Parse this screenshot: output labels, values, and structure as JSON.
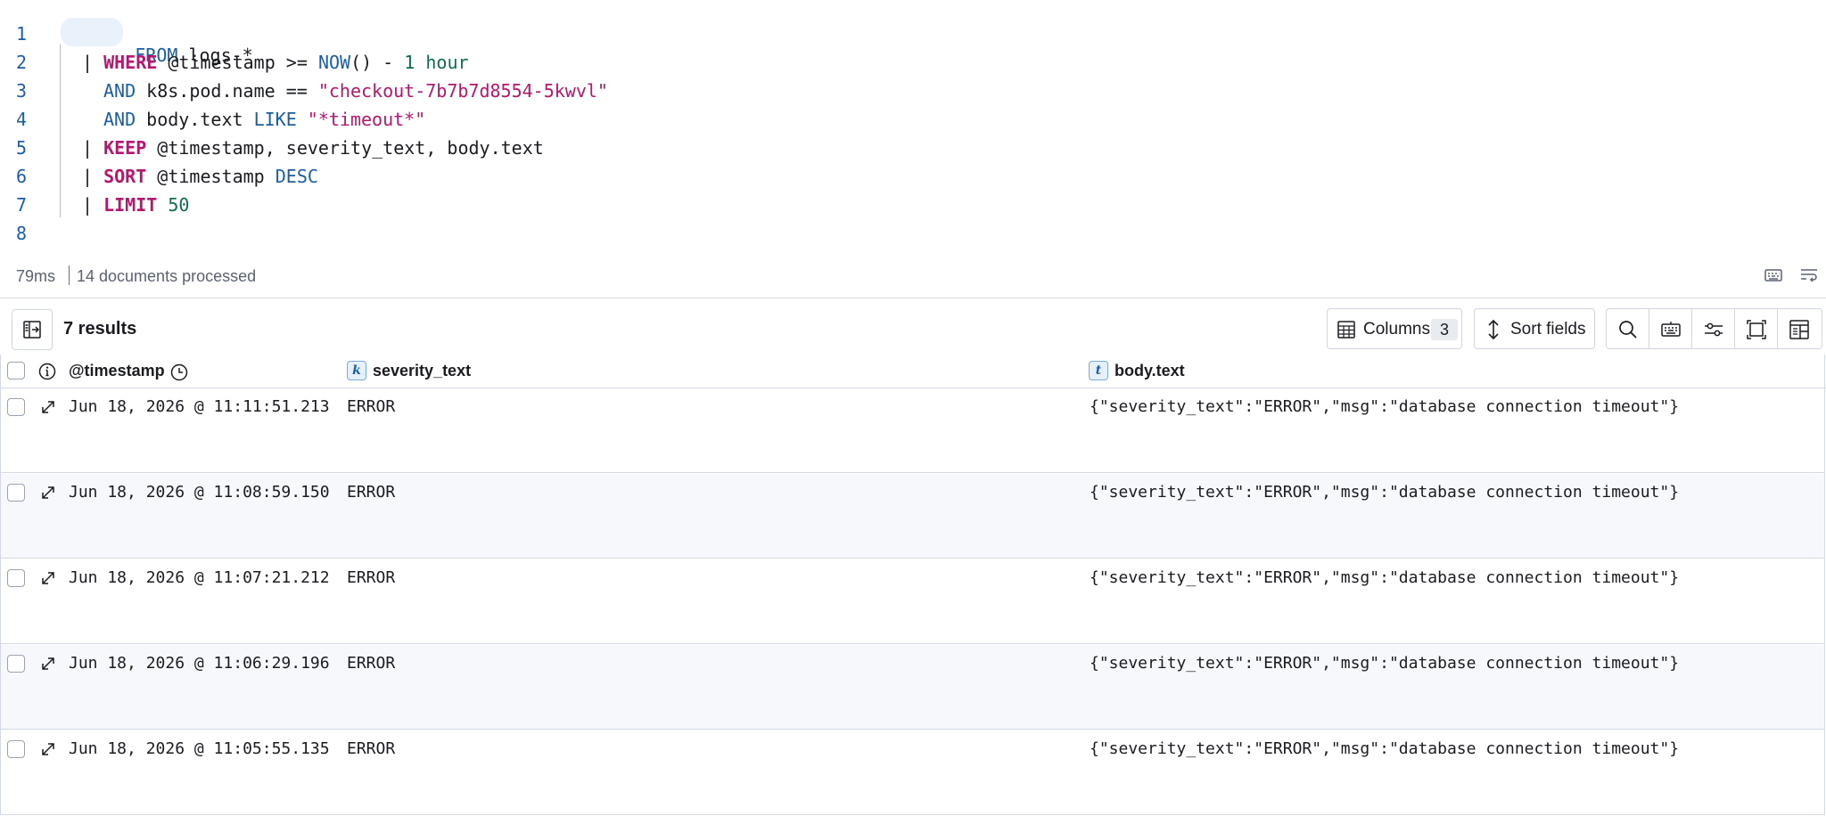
{
  "editor": {
    "lines": [
      {
        "num": "1",
        "parts": [
          {
            "t": "FROM",
            "c": "kw-blue"
          },
          {
            "t": " logs-*",
            "c": ""
          }
        ]
      },
      {
        "num": "2",
        "parts": [
          {
            "t": "| ",
            "c": "pipe"
          },
          {
            "t": "WHERE",
            "c": "kw-pink"
          },
          {
            "t": " @timestamp >= ",
            "c": ""
          },
          {
            "t": "NOW",
            "c": "kw-blue"
          },
          {
            "t": "() - ",
            "c": ""
          },
          {
            "t": "1 hour",
            "c": "num"
          }
        ]
      },
      {
        "num": "3",
        "parts": [
          {
            "t": "AND",
            "c": "kw-blue"
          },
          {
            "t": " k8s.pod.name == ",
            "c": ""
          },
          {
            "t": "\"checkout-7b7b7d8554-5kwvl\"",
            "c": "str"
          }
        ]
      },
      {
        "num": "4",
        "parts": [
          {
            "t": "AND",
            "c": "kw-blue"
          },
          {
            "t": " body.text ",
            "c": ""
          },
          {
            "t": "LIKE",
            "c": "kw-blue"
          },
          {
            "t": " ",
            "c": ""
          },
          {
            "t": "\"*timeout*\"",
            "c": "str"
          }
        ]
      },
      {
        "num": "5",
        "parts": [
          {
            "t": "| ",
            "c": "pipe"
          },
          {
            "t": "KEEP",
            "c": "kw-pink"
          },
          {
            "t": " @timestamp, severity_text, body.text",
            "c": ""
          }
        ]
      },
      {
        "num": "6",
        "parts": [
          {
            "t": "| ",
            "c": "pipe"
          },
          {
            "t": "SORT",
            "c": "kw-pink"
          },
          {
            "t": " @timestamp ",
            "c": ""
          },
          {
            "t": "DESC",
            "c": "kw-blue"
          }
        ]
      },
      {
        "num": "7",
        "parts": [
          {
            "t": "| ",
            "c": "pipe"
          },
          {
            "t": "LIMIT",
            "c": "kw-pink"
          },
          {
            "t": " ",
            "c": ""
          },
          {
            "t": "50",
            "c": "num"
          }
        ]
      },
      {
        "num": "8",
        "parts": []
      }
    ]
  },
  "status": {
    "duration": "79ms",
    "documents": "14 documents processed",
    "keyboard_icon": "keyboard-icon",
    "wrap_icon": "text-wrap-icon"
  },
  "toolbar": {
    "results": "7 results",
    "columns_label": "Columns",
    "columns_count": "3",
    "sort_label": "Sort fields",
    "icons": [
      "search-icon",
      "keyboard-icon",
      "display-options-icon",
      "fullscreen-icon",
      "layout-icon"
    ]
  },
  "grid": {
    "headers": {
      "timestamp": "@timestamp",
      "severity": "severity_text",
      "severity_type": "k",
      "body": "body.text",
      "body_type": "t"
    },
    "rows": [
      {
        "timestamp": "Jun 18, 2026 @ 11:11:51.213",
        "severity": "ERROR",
        "body": "{\"severity_text\":\"ERROR\",\"msg\":\"database connection timeout\"}"
      },
      {
        "timestamp": "Jun 18, 2026 @ 11:08:59.150",
        "severity": "ERROR",
        "body": "{\"severity_text\":\"ERROR\",\"msg\":\"database connection timeout\"}"
      },
      {
        "timestamp": "Jun 18, 2026 @ 11:07:21.212",
        "severity": "ERROR",
        "body": "{\"severity_text\":\"ERROR\",\"msg\":\"database connection timeout\"}"
      },
      {
        "timestamp": "Jun 18, 2026 @ 11:06:29.196",
        "severity": "ERROR",
        "body": "{\"severity_text\":\"ERROR\",\"msg\":\"database connection timeout\"}"
      },
      {
        "timestamp": "Jun 18, 2026 @ 11:05:55.135",
        "severity": "ERROR",
        "body": "{\"severity_text\":\"ERROR\",\"msg\":\"database connection timeout\"}"
      }
    ]
  },
  "colors": {
    "keyword_blue": "#1a5fa4",
    "keyword_pink": "#b3186e",
    "number_green": "#0e6d52",
    "border": "#d3dae6",
    "alt_row": "#f7f8fc"
  }
}
